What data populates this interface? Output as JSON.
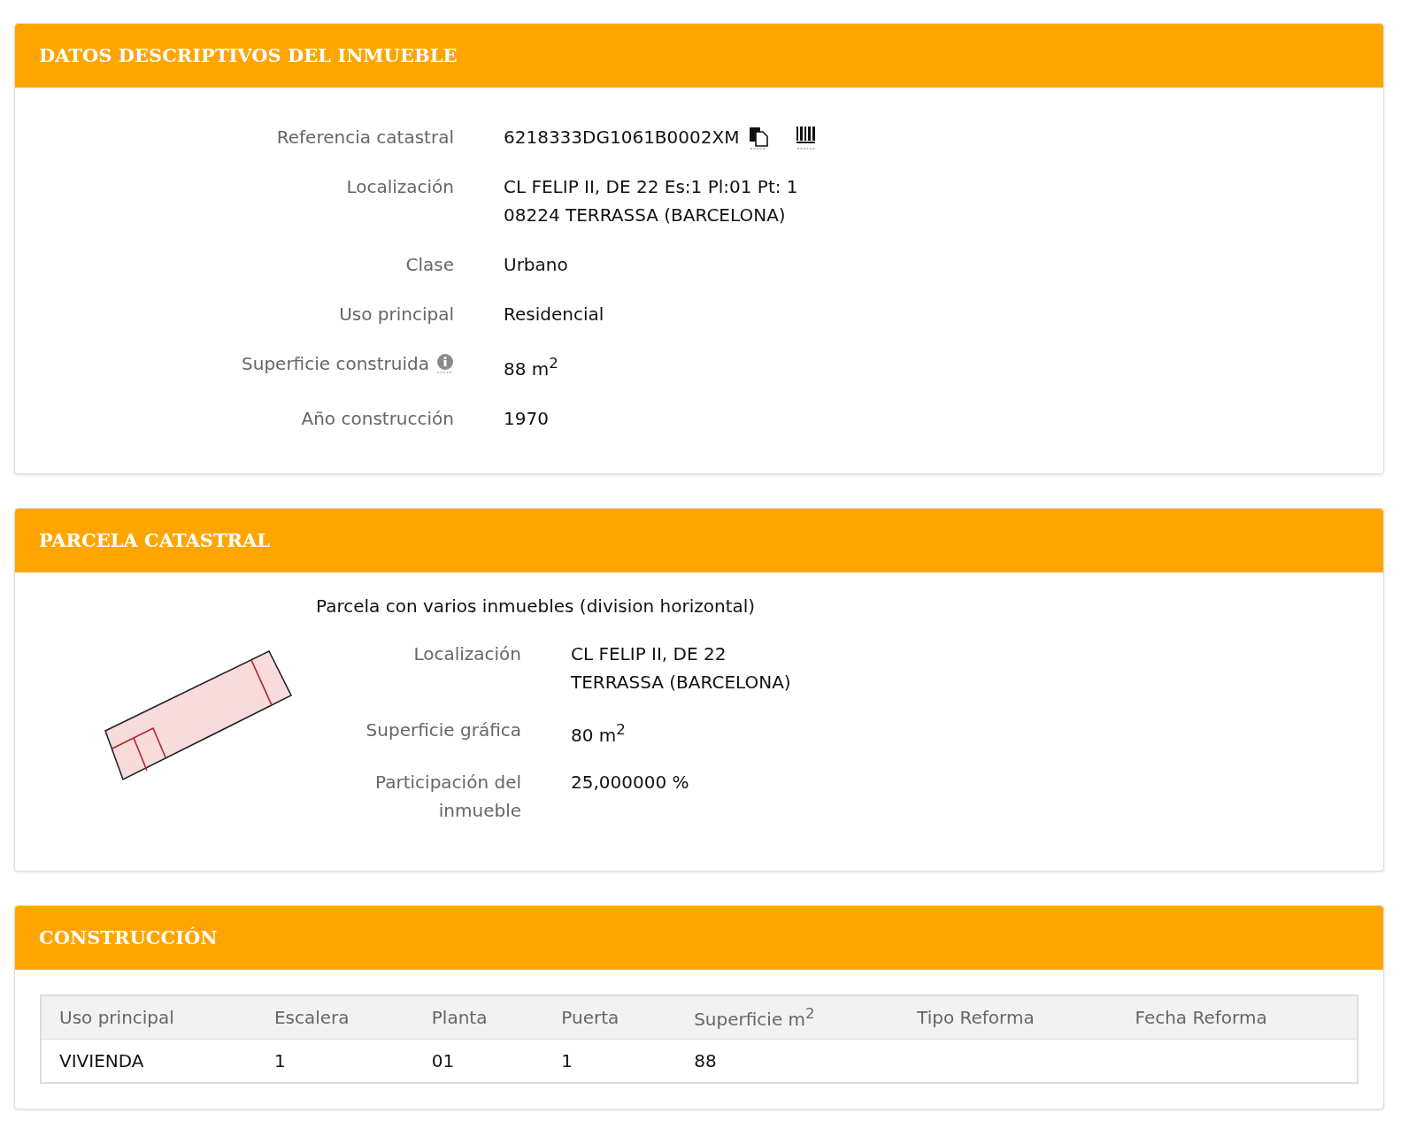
{
  "descriptive": {
    "title": "DATOS DESCRIPTIVOS DEL INMUEBLE",
    "fields": [
      {
        "label": "Referencia catastral",
        "lines": [
          "6218333DG1061B0002XM"
        ],
        "kind": "reference"
      },
      {
        "label": "Localización",
        "lines": [
          "CL FELIP II, DE 22 Es:1 Pl:01 Pt: 1",
          "08224 TERRASSA (BARCELONA)"
        ],
        "kind": "text"
      },
      {
        "label": "Clase",
        "lines": [
          "Urbano"
        ],
        "kind": "text"
      },
      {
        "label": "Uso principal",
        "lines": [
          "Residencial"
        ],
        "kind": "text"
      },
      {
        "label": "Superficie construida",
        "lines": [
          "88 m$^{2}$"
        ],
        "kind": "info"
      },
      {
        "label": "Año construcción",
        "lines": [
          "1970"
        ],
        "kind": "text"
      }
    ]
  },
  "parcel": {
    "title": "PARCELA CATASTRAL",
    "heading": "Parcela con varios inmuebles (division horizontal)",
    "fields": [
      {
        "label": "Localización",
        "lines": [
          "CL FELIP II, DE 22",
          "TERRASSA (BARCELONA)"
        ]
      },
      {
        "label": "Superficie gráfica",
        "lines": [
          "80 m$^{2}$"
        ]
      },
      {
        "label": "Participación del inmueble",
        "lines": [
          "25,000000 %"
        ]
      }
    ]
  },
  "construction": {
    "title": "CONSTRUCCIÓN",
    "table": {
      "columns": [
        "Uso principal",
        "Escalera",
        "Planta",
        "Puerta",
        "Superficie m$^{2}$",
        "Tipo Reforma",
        "Fecha Reforma"
      ],
      "rows": [
        [
          "VIVIENDA",
          "1",
          "01",
          "1",
          "88",
          "",
          ""
        ]
      ]
    }
  }
}
